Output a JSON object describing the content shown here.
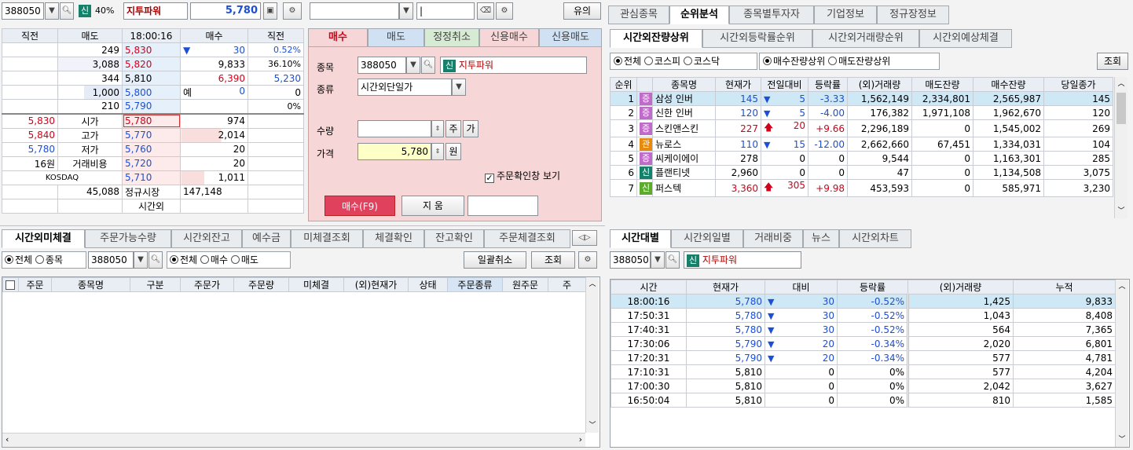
{
  "quote": {
    "code": "388050",
    "badge": "신",
    "margin": "40%",
    "name": "지투파워",
    "price": "5,780",
    "headers": [
      "직전",
      "매도",
      "18:00:16",
      "매수",
      "직전"
    ],
    "asks": [
      {
        "vol": "249",
        "price": "5,830"
      },
      {
        "vol": "3,088",
        "price": "5,820"
      },
      {
        "vol": "344",
        "price": "5,810"
      },
      {
        "vol": "1,000",
        "price": "5,800"
      },
      {
        "vol": "210",
        "price": "5,790"
      }
    ],
    "right_info": [
      {
        "mark": "▼",
        "a": "30",
        "b": "0.52%"
      },
      {
        "mark": "",
        "a": "9,833",
        "b": "36.10%"
      },
      {
        "mark": "",
        "a": "6,390",
        "b": "5,230"
      },
      {
        "mark": "예",
        "a": "0",
        "b": "0"
      },
      {
        "mark": "",
        "a": "",
        "b": "0%"
      }
    ],
    "left_info": [
      {
        "v": "5,830",
        "k": "시가"
      },
      {
        "v": "5,840",
        "k": "고가"
      },
      {
        "v": "5,780",
        "k": "저가"
      },
      {
        "v": "16원",
        "k": "거래비용"
      },
      {
        "v": "",
        "k": "KOSDAQ"
      }
    ],
    "bids": [
      {
        "price": "5,780",
        "vol": "974"
      },
      {
        "price": "5,770",
        "vol": "2,014"
      },
      {
        "price": "5,760",
        "vol": "20"
      },
      {
        "price": "5,720",
        "vol": "20"
      },
      {
        "price": "5,710",
        "vol": "1,011"
      }
    ],
    "total_ask": "45,088",
    "regular_label": "정규시장",
    "total_bid": "147,148",
    "after_label": "시간외"
  },
  "order": {
    "top_right_btn": "유의",
    "tabs": [
      "매수",
      "매도",
      "정정취소",
      "신용매수",
      "신용매도"
    ],
    "labels": {
      "item": "종목",
      "type": "종류",
      "qty": "수량",
      "price": "가격"
    },
    "code": "388050",
    "badge": "신",
    "name": "지투파워",
    "order_type": "시간외단일가",
    "qty_unit": "주",
    "qty_btn": "가",
    "price": "5,780",
    "price_unit": "원",
    "confirm_label": "주문확인창 보기",
    "buy_btn": "매수(F9)",
    "clear_btn": "지 움"
  },
  "right_top": {
    "tabs": [
      "관심종목",
      "순위분석",
      "종목별투자자",
      "기업정보",
      "정규장정보"
    ],
    "subtabs": [
      "시간외잔량상위",
      "시간외등락률순위",
      "시간외거래량순위",
      "시간외예상체결"
    ],
    "filters": [
      "전체",
      "코스피",
      "코스닥"
    ],
    "sort": [
      "매수잔량상위",
      "매도잔량상위"
    ],
    "query_btn": "조회",
    "columns": [
      "순위",
      "",
      "종목명",
      "현재가",
      "전일대비",
      "등락률",
      "(외)거래량",
      "매도잔량",
      "매수잔량",
      "당일종가"
    ],
    "rows": [
      {
        "rank": "1",
        "badge": "증",
        "badge_type": "jeung",
        "name": "삼성 인버",
        "price": "145",
        "dir": "down",
        "chg": "5",
        "rate": "-3.33",
        "vol": "1,562,149",
        "ask": "2,334,801",
        "bid": "2,565,987",
        "close": "145",
        "color": "blue"
      },
      {
        "rank": "2",
        "badge": "증",
        "badge_type": "jeung",
        "name": "신한 인버",
        "price": "120",
        "dir": "down",
        "chg": "5",
        "rate": "-4.00",
        "vol": "176,382",
        "ask": "1,971,108",
        "bid": "1,962,670",
        "close": "120",
        "color": "blue"
      },
      {
        "rank": "3",
        "badge": "증",
        "badge_type": "jeung",
        "name": "스킨앤스킨",
        "price": "227",
        "dir": "up",
        "chg": "20",
        "rate": "+9.66",
        "vol": "2,296,189",
        "ask": "0",
        "bid": "1,545,002",
        "close": "269",
        "color": "red"
      },
      {
        "rank": "4",
        "badge": "관",
        "badge_type": "gwan",
        "name": "뉴로스",
        "price": "110",
        "dir": "down",
        "chg": "15",
        "rate": "-12.00",
        "vol": "2,662,660",
        "ask": "67,451",
        "bid": "1,334,031",
        "close": "104",
        "color": "blue"
      },
      {
        "rank": "5",
        "badge": "증",
        "badge_type": "jeung",
        "name": "씨케이에이",
        "price": "278",
        "dir": "",
        "chg": "0",
        "rate": "0",
        "vol": "9,544",
        "ask": "0",
        "bid": "1,163,301",
        "close": "285",
        "color": ""
      },
      {
        "rank": "6",
        "badge": "신",
        "badge_type": "sin",
        "name": "플랜티넷",
        "price": "2,960",
        "dir": "",
        "chg": "0",
        "rate": "0",
        "vol": "47",
        "ask": "0",
        "bid": "1,134,508",
        "close": "3,075",
        "color": ""
      },
      {
        "rank": "7",
        "badge": "신",
        "badge_type": "sin2",
        "name": "퍼스텍",
        "price": "3,360",
        "dir": "up",
        "chg": "305",
        "rate": "+9.98",
        "vol": "453,593",
        "ask": "0",
        "bid": "585,971",
        "close": "3,230",
        "color": "red"
      }
    ]
  },
  "bottom_left": {
    "tabs": [
      "시간외미체결",
      "주문가능수량",
      "시간외잔고",
      "예수금",
      "미체결조회",
      "체결확인",
      "잔고확인",
      "주문체결조회"
    ],
    "filters": [
      "전체",
      "종목"
    ],
    "code": "388050",
    "side": [
      "전체",
      "매수",
      "매도"
    ],
    "cancel_all": "일괄취소",
    "query_btn": "조회",
    "columns": [
      "주문",
      "종목명",
      "구분",
      "주문가",
      "주문량",
      "미체결",
      "(외)현재가",
      "상태",
      "주문종류",
      "원주문",
      "주"
    ]
  },
  "bottom_right": {
    "tabs": [
      "시간대별",
      "시간외일별",
      "거래비중",
      "뉴스",
      "시간외차트"
    ],
    "code": "388050",
    "badge": "신",
    "name": "지투파워",
    "columns": [
      "시간",
      "현재가",
      "대비",
      "등락률",
      "(외)거래량",
      "누적"
    ],
    "rows": [
      {
        "time": "18:00:16",
        "price": "5,780",
        "dir": "down",
        "chg": "30",
        "rate": "-0.52%",
        "vol": "1,425",
        "cum": "9,833",
        "color": "blue"
      },
      {
        "time": "17:50:31",
        "price": "5,780",
        "dir": "down",
        "chg": "30",
        "rate": "-0.52%",
        "vol": "1,043",
        "cum": "8,408",
        "color": "blue"
      },
      {
        "time": "17:40:31",
        "price": "5,780",
        "dir": "down",
        "chg": "30",
        "rate": "-0.52%",
        "vol": "564",
        "cum": "7,365",
        "color": "blue"
      },
      {
        "time": "17:30:06",
        "price": "5,790",
        "dir": "down",
        "chg": "20",
        "rate": "-0.34%",
        "vol": "2,020",
        "cum": "6,801",
        "color": "blue"
      },
      {
        "time": "17:20:31",
        "price": "5,790",
        "dir": "down",
        "chg": "20",
        "rate": "-0.34%",
        "vol": "577",
        "cum": "4,781",
        "color": "blue"
      },
      {
        "time": "17:10:31",
        "price": "5,810",
        "dir": "",
        "chg": "0",
        "rate": "0%",
        "vol": "577",
        "cum": "4,204",
        "color": ""
      },
      {
        "time": "17:00:30",
        "price": "5,810",
        "dir": "",
        "chg": "0",
        "rate": "0%",
        "vol": "2,042",
        "cum": "3,627",
        "color": ""
      },
      {
        "time": "16:50:04",
        "price": "5,810",
        "dir": "",
        "chg": "0",
        "rate": "0%",
        "vol": "810",
        "cum": "1,585",
        "color": ""
      }
    ]
  },
  "colors": {
    "red": "#d0021b",
    "blue": "#1c4fd6",
    "pink_panel": "#f6d6d6",
    "sel_row": "#cfe8f5",
    "buy_btn": "#e0415c"
  },
  "icons": [
    "search-icon",
    "gear-icon",
    "chevron-down-icon",
    "eraser-icon",
    "chart-icon",
    "scroll-up-icon",
    "scroll-down-icon"
  ]
}
